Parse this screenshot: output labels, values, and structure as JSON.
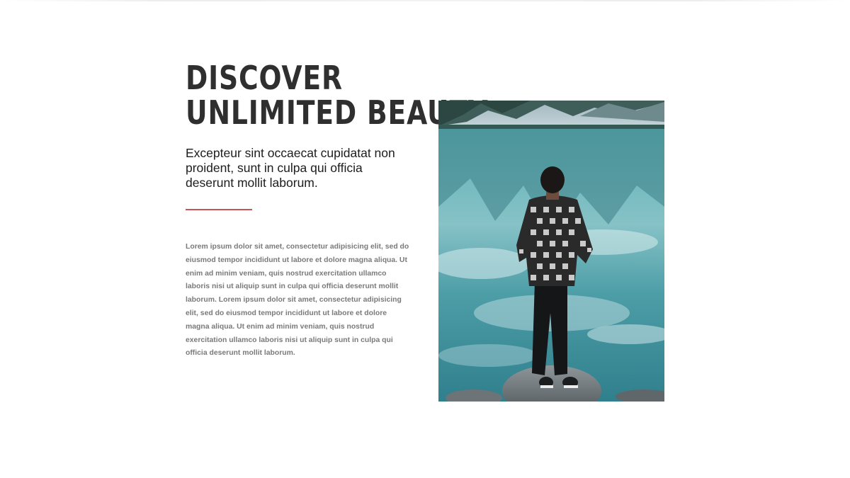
{
  "hero": {
    "heading_line1": "DISCOVER",
    "heading_line2": "UNLIMITED BEAUTY",
    "subheading": "Excepteur sint occaecat cupidatat non proident, sunt in culpa qui officia deserunt mollit laborum.",
    "body": "Lorem ipsum dolor sit amet, consectetur adipisicing elit, sed do eiusmod tempor incididunt ut labore et dolore magna aliqua. Ut enim ad minim veniam, quis nostrud exercitation ullamco laboris nisi ut aliquip sunt in culpa qui officia deserunt mollit laborum. Lorem ipsum dolor sit amet, consectetur adipisicing elit, sed do eiusmod tempor incididunt ut labore et dolore magna aliqua. Ut enim ad minim veniam, quis nostrud exercitation ullamco laboris nisi ut aliquip sunt in culpa qui officia deserunt mollit laborum."
  },
  "colors": {
    "heading": "#2f2f2f",
    "accent_divider": "#c9555a",
    "body_text": "#7a7a7a",
    "lake": "#4fa3ab"
  },
  "image": {
    "icon": "person-standing-by-lake-photo"
  }
}
